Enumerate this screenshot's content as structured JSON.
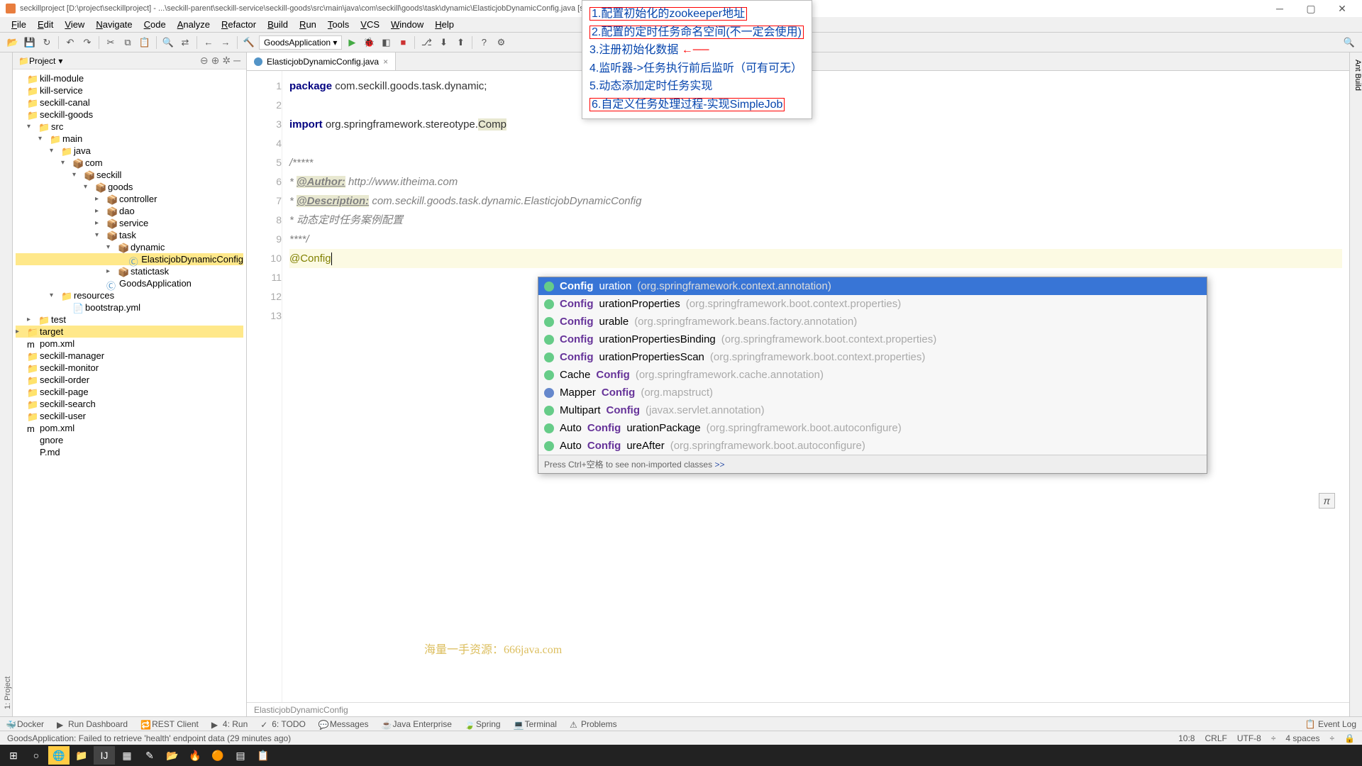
{
  "titlebar": {
    "project": "seckillproject",
    "path": "[D:\\project\\seckillproject] - ...\\seckill-parent\\seckill-service\\seckill-goods\\src\\main\\java\\com\\seckill\\goods\\task\\dynamic\\ElasticjobDynamicConfig.java [seckill-goods] - I"
  },
  "menubar": [
    "File",
    "Edit",
    "View",
    "Navigate",
    "Code",
    "Analyze",
    "Refactor",
    "Build",
    "Run",
    "Tools",
    "VCS",
    "Window",
    "Help"
  ],
  "combo": "GoodsApplication",
  "project_pane": {
    "title": "Project"
  },
  "tree": [
    {
      "ind": 0,
      "arrow": "",
      "icon": "📁",
      "label": "kill-module"
    },
    {
      "ind": 0,
      "arrow": "",
      "icon": "📁",
      "label": "kill-service"
    },
    {
      "ind": 0,
      "arrow": "",
      "icon": "📁",
      "label": "seckill-canal"
    },
    {
      "ind": 0,
      "arrow": "",
      "icon": "📁",
      "label": "seckill-goods"
    },
    {
      "ind": 1,
      "arrow": "▾",
      "icon": "📁",
      "label": "src",
      "folder": true
    },
    {
      "ind": 2,
      "arrow": "▾",
      "icon": "📁",
      "label": "main",
      "folder": true
    },
    {
      "ind": 3,
      "arrow": "▾",
      "icon": "📁",
      "label": "java",
      "cls": "package",
      "folder": true
    },
    {
      "ind": 4,
      "arrow": "▾",
      "icon": "📦",
      "label": "com",
      "cls": "package"
    },
    {
      "ind": 5,
      "arrow": "▾",
      "icon": "📦",
      "label": "seckill",
      "cls": "package"
    },
    {
      "ind": 6,
      "arrow": "▾",
      "icon": "📦",
      "label": "goods",
      "cls": "package"
    },
    {
      "ind": 7,
      "arrow": "▸",
      "icon": "📦",
      "label": "controller",
      "cls": "package"
    },
    {
      "ind": 7,
      "arrow": "▸",
      "icon": "📦",
      "label": "dao",
      "cls": "package"
    },
    {
      "ind": 7,
      "arrow": "▸",
      "icon": "📦",
      "label": "service",
      "cls": "package"
    },
    {
      "ind": 7,
      "arrow": "▾",
      "icon": "📦",
      "label": "task",
      "cls": "package"
    },
    {
      "ind": 8,
      "arrow": "▾",
      "icon": "📦",
      "label": "dynamic",
      "cls": "package"
    },
    {
      "ind": 9,
      "arrow": "",
      "icon": "Ⓒ",
      "label": "ElasticjobDynamicConfig",
      "cls": "jclass",
      "sel": true
    },
    {
      "ind": 8,
      "arrow": "▸",
      "icon": "📦",
      "label": "statictask",
      "cls": "package"
    },
    {
      "ind": 7,
      "arrow": "",
      "icon": "Ⓒ",
      "label": "GoodsApplication",
      "cls": "jclass"
    },
    {
      "ind": 3,
      "arrow": "▾",
      "icon": "📁",
      "label": "resources",
      "folder": true
    },
    {
      "ind": 4,
      "arrow": "",
      "icon": "📄",
      "label": "bootstrap.yml"
    },
    {
      "ind": 1,
      "arrow": "▸",
      "icon": "📁",
      "label": "test",
      "folder": true
    },
    {
      "ind": 0,
      "arrow": "▸",
      "icon": "📁",
      "label": "target",
      "sel": true
    },
    {
      "ind": 0,
      "arrow": "",
      "icon": "m",
      "label": "pom.xml"
    },
    {
      "ind": 0,
      "arrow": "",
      "icon": "📁",
      "label": "seckill-manager"
    },
    {
      "ind": 0,
      "arrow": "",
      "icon": "📁",
      "label": "seckill-monitor"
    },
    {
      "ind": 0,
      "arrow": "",
      "icon": "📁",
      "label": "seckill-order"
    },
    {
      "ind": 0,
      "arrow": "",
      "icon": "📁",
      "label": "seckill-page"
    },
    {
      "ind": 0,
      "arrow": "",
      "icon": "📁",
      "label": "seckill-search"
    },
    {
      "ind": 0,
      "arrow": "",
      "icon": "📁",
      "label": "seckill-user"
    },
    {
      "ind": 0,
      "arrow": "",
      "icon": "m",
      "label": "pom.xml"
    },
    {
      "ind": 0,
      "arrow": "",
      "icon": "",
      "label": "gnore"
    },
    {
      "ind": 0,
      "arrow": "",
      "icon": "",
      "label": "P.md"
    }
  ],
  "tab": {
    "name": "ElasticjobDynamicConfig.java"
  },
  "code_lines": [
    "1",
    "2",
    "3",
    "4",
    "5",
    "6",
    "7",
    "8",
    "9",
    "10",
    "11",
    "12",
    "13"
  ],
  "code": {
    "l1a": "package",
    "l1b": " com.seckill.goods.task.dynamic;",
    "l3a": "import",
    "l3b": " org.springframework.stereotype.",
    "l3c": "Comp",
    "l5": "/*****",
    "l6a": " * ",
    "l6b": "@Author:",
    "l6c": "  http://www.itheima.com",
    "l7a": " * ",
    "l7b": "@Description:",
    "l7c": "  com.seckill.goods.task.dynamic.ElasticjobDynamicConfig",
    "l8": " * 动态定时任务案例配置",
    "l9": " ****/",
    "l10": "@Config"
  },
  "notes": [
    "1.配置初始化的zookeeper地址",
    "2.配置的定时任务命名空间(不一定会使用)",
    "3.注册初始化数据",
    "4.监听器->任务执行前后监听（可有可无）",
    "5.动态添加定时任务实现",
    "6.自定义任务处理过程-实现SimpleJob"
  ],
  "autocomplete": [
    {
      "match": "Config",
      "rest": "uration",
      "pkg": "(org.springframework.context.annotation)",
      "sel": true
    },
    {
      "match": "Config",
      "rest": "urationProperties",
      "pkg": "(org.springframework.boot.context.properties)"
    },
    {
      "match": "Config",
      "rest": "urable",
      "pkg": "(org.springframework.beans.factory.annotation)"
    },
    {
      "match": "Config",
      "rest": "urationPropertiesBinding",
      "pkg": "(org.springframework.boot.context.properties)"
    },
    {
      "match": "Config",
      "rest": "urationPropertiesScan",
      "pkg": "(org.springframework.boot.context.properties)"
    },
    {
      "pre": "Cache",
      "match": "Config",
      "rest": "",
      "pkg": "(org.springframework.cache.annotation)"
    },
    {
      "pre": "Mapper",
      "match": "Config",
      "rest": "",
      "pkg": "(org.mapstruct)",
      "icblue": true
    },
    {
      "pre": "Multipart",
      "match": "Config",
      "rest": "",
      "pkg": "(javax.servlet.annotation)"
    },
    {
      "pre": "Auto",
      "match": "Config",
      "rest": "urationPackage",
      "pkg": "(org.springframework.boot.autoconfigure)"
    },
    {
      "pre": "Auto",
      "match": "Config",
      "rest": "ureAfter",
      "pkg": "(org.springframework.boot.autoconfigure)"
    }
  ],
  "ac_hint": "Press Ctrl+空格 to see non-imported classes  ",
  "ac_hint_link": ">>",
  "breadcrumb": "ElasticjobDynamicConfig",
  "bottom": [
    {
      "ic": "🐳",
      "label": "Docker"
    },
    {
      "ic": "▶",
      "label": "Run Dashboard"
    },
    {
      "ic": "🔁",
      "label": "REST Client"
    },
    {
      "ic": "▶",
      "label": "4: Run"
    },
    {
      "ic": "✓",
      "label": "6: TODO"
    },
    {
      "ic": "💬",
      "label": "Messages"
    },
    {
      "ic": "☕",
      "label": "Java Enterprise"
    },
    {
      "ic": "🍃",
      "label": "Spring"
    },
    {
      "ic": "💻",
      "label": "Terminal"
    },
    {
      "ic": "⚠",
      "label": "Problems"
    }
  ],
  "eventlog": "Event Log",
  "status": {
    "msg": "GoodsApplication: Failed to retrieve 'health' endpoint data (29 minutes ago)",
    "pos": "10:8",
    "eol": "CRLF",
    "enc": "UTF-8",
    "spaces": "4 spaces"
  },
  "watermark": "海量一手资源：666java.com"
}
